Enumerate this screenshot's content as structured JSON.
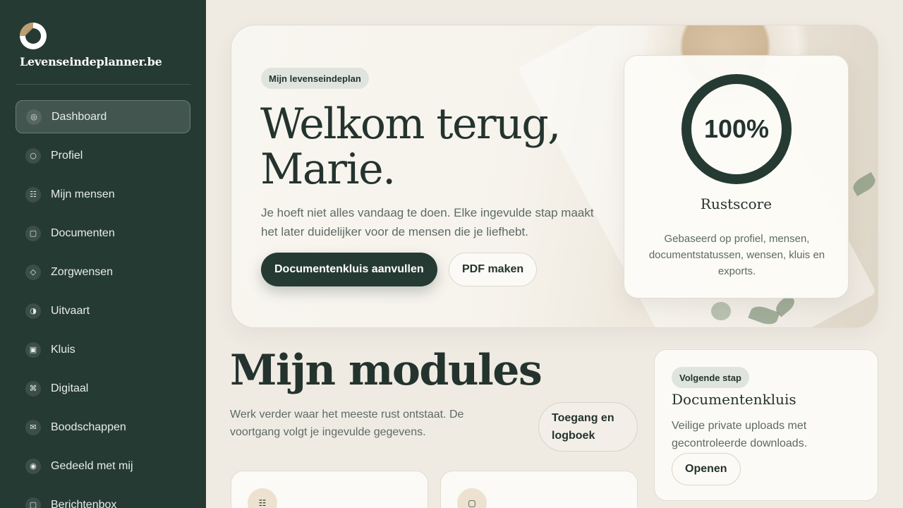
{
  "brand": {
    "name": "Levenseindeplanner.be"
  },
  "sidebar": {
    "items": [
      {
        "label": "Dashboard",
        "icon": "dashboard-icon",
        "glyph": "◎",
        "active": true
      },
      {
        "label": "Profiel",
        "icon": "profile-icon",
        "glyph": "○",
        "active": false
      },
      {
        "label": "Mijn mensen",
        "icon": "people-icon",
        "glyph": "☷",
        "active": false
      },
      {
        "label": "Documenten",
        "icon": "documents-icon",
        "glyph": "▢",
        "active": false
      },
      {
        "label": "Zorgwensen",
        "icon": "care-wishes-icon",
        "glyph": "◇",
        "active": false
      },
      {
        "label": "Uitvaart",
        "icon": "funeral-icon",
        "glyph": "◑",
        "active": false
      },
      {
        "label": "Kluis",
        "icon": "vault-icon",
        "glyph": "▣",
        "active": false
      },
      {
        "label": "Digitaal",
        "icon": "digital-icon",
        "glyph": "⌘",
        "active": false
      },
      {
        "label": "Boodschappen",
        "icon": "messages-icon",
        "glyph": "✉",
        "active": false
      },
      {
        "label": "Gedeeld met mij",
        "icon": "shared-icon",
        "glyph": "◉",
        "active": false
      },
      {
        "label": "Berichtenbox",
        "icon": "inbox-icon",
        "glyph": "▢",
        "active": false
      }
    ]
  },
  "hero": {
    "badge": "Mijn levenseindeplan",
    "title": "Welkom terug, Marie.",
    "text": "Je hoeft niet alles vandaag te doen. Elke ingevulde stap maakt het later duidelijker voor de mensen die je liefhebt.",
    "primary_button": "Documentenkluis aanvullen",
    "secondary_button": "PDF maken"
  },
  "score": {
    "value": "100%",
    "progress": 1.0,
    "label": "Rustscore",
    "description": "Gebaseerd op profiel, mensen, documentstatussen, wensen, kluis en exports."
  },
  "modules": {
    "title": "Mijn modules",
    "subtitle": "Werk verder waar het meeste rust ontstaat. De voortgang volgt je ingevulde gegevens.",
    "access_button": "Toegang en logboek",
    "cards": [
      {
        "icon": "people-icon",
        "glyph": "☷"
      },
      {
        "icon": "documents-icon",
        "glyph": "▢"
      }
    ]
  },
  "next_step": {
    "badge": "Volgende stap",
    "title": "Documentenkluis",
    "description": "Veilige private uploads met gecontroleerde downloads.",
    "button": "Openen"
  },
  "colors": {
    "sidebar_bg": "#263a34",
    "accent": "#263a34",
    "badge_bg": "#dfe5de",
    "page_bg": "#efebe3"
  }
}
